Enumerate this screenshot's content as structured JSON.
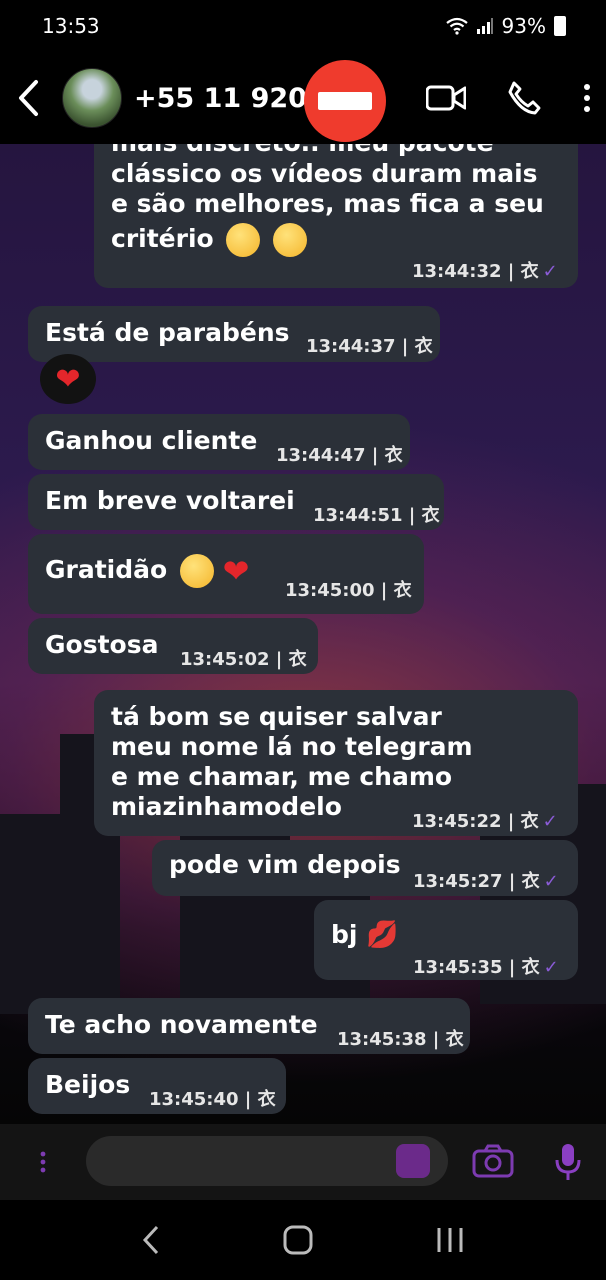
{
  "status_bar": {
    "time": "13:53",
    "battery": "93%"
  },
  "header": {
    "contact_name": "+55 11 9200"
  },
  "messages": [
    {
      "text_lines": [
        "mais discreto.. meu pacote",
        "clássico os vídeos duram mais",
        "e são melhores, mas fica a seu",
        "critério"
      ],
      "time": "13:44:32 | 衣",
      "direction": "outgoing"
    },
    {
      "text": "Está de parabéns",
      "time": "13:44:37 | 衣",
      "direction": "incoming"
    },
    {
      "text": "Ganhou cliente",
      "time": "13:44:47 | 衣",
      "direction": "incoming"
    },
    {
      "text": "Em breve voltarei",
      "time": "13:44:51 | 衣",
      "direction": "incoming"
    },
    {
      "text": "Gratidão",
      "time": "13:45:00 | 衣",
      "direction": "incoming"
    },
    {
      "text": "Gostosa",
      "time": "13:45:02 | 衣",
      "direction": "incoming"
    },
    {
      "text_lines": [
        "tá bom se quiser salvar",
        "meu nome lá no telegram",
        "e me chamar, me chamo",
        "miazinhamodelo"
      ],
      "time": "13:45:22 | 衣",
      "direction": "outgoing"
    },
    {
      "text": "pode vim depois",
      "time": "13:45:27 | 衣",
      "direction": "outgoing"
    },
    {
      "text": "bj",
      "time": "13:45:35 | 衣",
      "direction": "outgoing"
    },
    {
      "text": "Te acho novamente",
      "time": "13:45:38 | 衣",
      "direction": "incoming"
    },
    {
      "text": "Beijos",
      "time": "13:45:40 | 衣",
      "direction": "incoming"
    }
  ],
  "reaction": {
    "emoji": "❤"
  },
  "colors": {
    "bubble": "#2b3038",
    "accent": "#8a5bd6",
    "redaction": "#ef3b2d"
  },
  "icons": [
    "back-arrow-icon",
    "video-call-icon",
    "phone-icon",
    "more-vert-icon",
    "attach-dots-icon",
    "sticker-icon",
    "camera-icon",
    "mic-icon",
    "nav-back-icon",
    "nav-home-icon",
    "nav-recents-icon"
  ]
}
